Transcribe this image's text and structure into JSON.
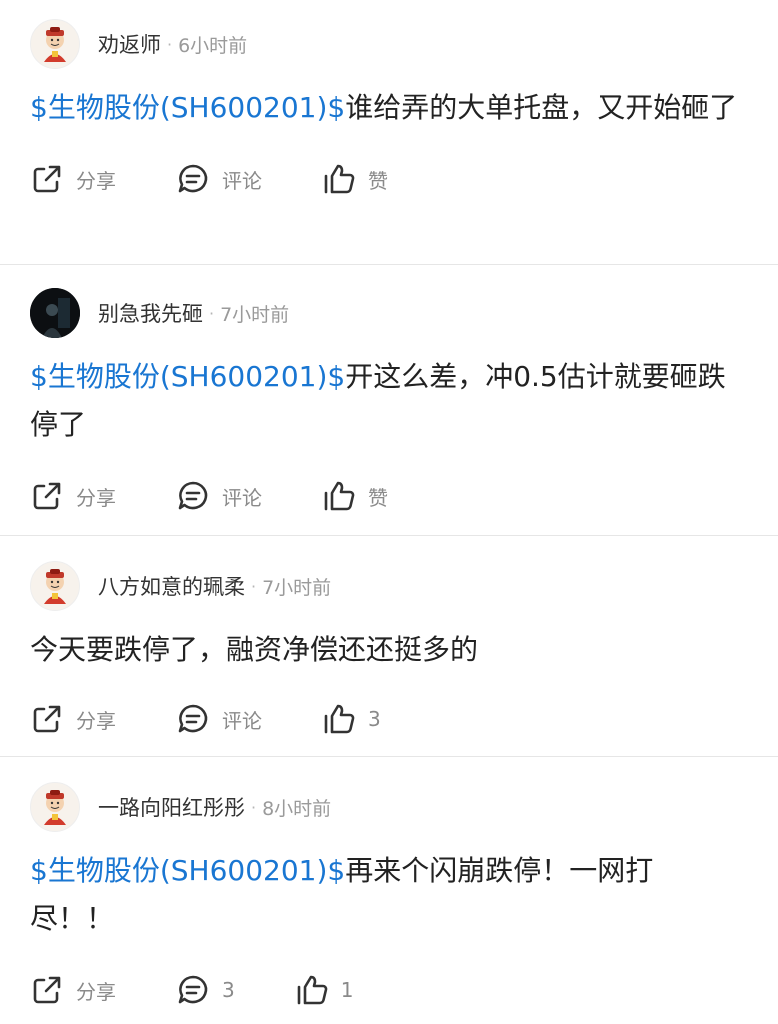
{
  "posts": [
    {
      "username": "劝返师",
      "time": "6小时前",
      "stock": "$生物股份(SH600201)$",
      "content": "谁给弄的大单托盘，又开始砸了",
      "share_label": "分享",
      "comment_label": "评论",
      "like_label": "赞"
    },
    {
      "username": "别急我先砸",
      "time": "7小时前",
      "stock": "$生物股份(SH600201)$",
      "content": "开这么差，冲0.5估计就要砸跌停了",
      "share_label": "分享",
      "comment_label": "评论",
      "like_label": "赞"
    },
    {
      "username": "八方如意的珮柔",
      "time": "7小时前",
      "stock": "",
      "content": "今天要跌停了，融资净偿还还挺多的",
      "share_label": "分享",
      "comment_label": "评论",
      "like_label": "3"
    },
    {
      "username": "一路向阳红彤彤",
      "time": "8小时前",
      "stock": "$生物股份(SH600201)$",
      "content": "再来个闪崩跌停！一网打尽！！",
      "share_label": "分享",
      "comment_label": "3",
      "like_label": "1"
    }
  ],
  "icons": {
    "share": "share-icon",
    "comment": "comment-icon",
    "like": "thumbs-up-icon",
    "avatar": "avatar"
  },
  "colors": {
    "stock_link": "#1976d2",
    "muted": "#9a9a9a"
  }
}
